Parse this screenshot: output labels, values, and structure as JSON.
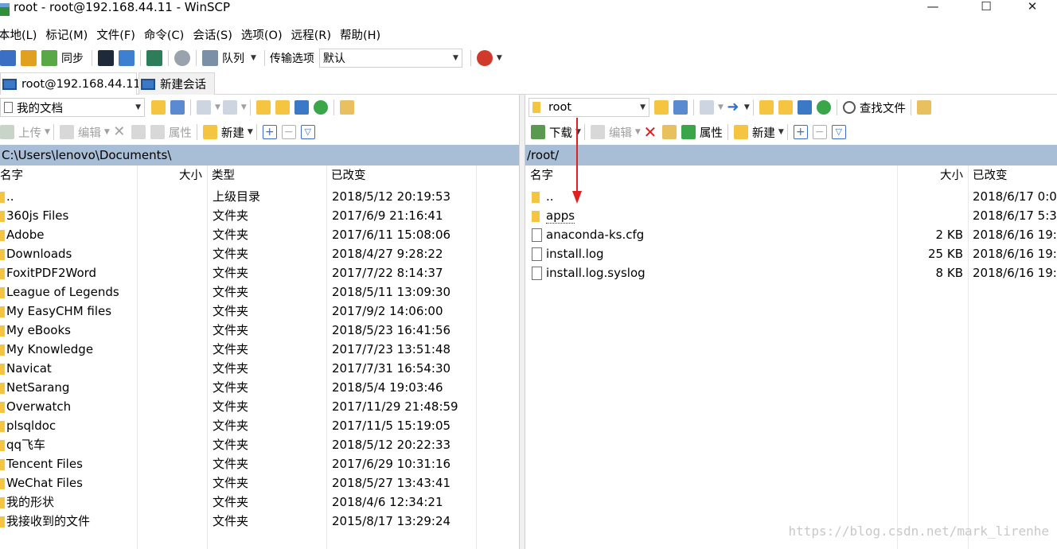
{
  "window": {
    "title": "root - root@192.168.44.11 - WinSCP",
    "minimize": "—",
    "maximize": "☐",
    "close": "✕"
  },
  "menu": [
    "本地(L)",
    "标记(M)",
    "文件(F)",
    "命令(C)",
    "会话(S)",
    "选项(O)",
    "远程(R)",
    "帮助(H)"
  ],
  "toolbar": {
    "sync_label": "同步",
    "queue_label": "队列",
    "transfer_options_label": "传输选项",
    "transfer_value": "默认"
  },
  "tabs": {
    "active": "root@192.168.44.11",
    "new_session": "新建会话"
  },
  "colors": {
    "path_bar": "#a8bdd6",
    "folder": "#f5c542",
    "delete_red": "#d92020",
    "arrow_red": "#e02020"
  },
  "left": {
    "location": "我的文档",
    "upload_label": "上传",
    "edit_label": "编辑",
    "properties_label": "属性",
    "new_label": "新建",
    "path": "C:\\Users\\lenovo\\Documents\\",
    "columns": {
      "name": "名字",
      "size": "大小",
      "type": "类型",
      "modified": "已改变"
    },
    "rows": [
      {
        "name": "..",
        "size": "",
        "type": "上级目录",
        "modified": "2018/5/12  20:19:53"
      },
      {
        "name": "360js Files",
        "size": "",
        "type": "文件夹",
        "modified": "2017/6/9  21:16:41"
      },
      {
        "name": "Adobe",
        "size": "",
        "type": "文件夹",
        "modified": "2017/6/11  15:08:06"
      },
      {
        "name": "Downloads",
        "size": "",
        "type": "文件夹",
        "modified": "2018/4/27  9:28:22"
      },
      {
        "name": "FoxitPDF2Word",
        "size": "",
        "type": "文件夹",
        "modified": "2017/7/22  8:14:37"
      },
      {
        "name": "League of Legends",
        "size": "",
        "type": "文件夹",
        "modified": "2018/5/11  13:09:30"
      },
      {
        "name": "My EasyCHM files",
        "size": "",
        "type": "文件夹",
        "modified": "2017/9/2  14:06:00"
      },
      {
        "name": "My eBooks",
        "size": "",
        "type": "文件夹",
        "modified": "2018/5/23  16:41:56"
      },
      {
        "name": "My Knowledge",
        "size": "",
        "type": "文件夹",
        "modified": "2017/7/23  13:51:48"
      },
      {
        "name": "Navicat",
        "size": "",
        "type": "文件夹",
        "modified": "2017/7/31  16:54:30"
      },
      {
        "name": "NetSarang",
        "size": "",
        "type": "文件夹",
        "modified": "2018/5/4  19:03:46"
      },
      {
        "name": "Overwatch",
        "size": "",
        "type": "文件夹",
        "modified": "2017/11/29  21:48:59"
      },
      {
        "name": "plsqldoc",
        "size": "",
        "type": "文件夹",
        "modified": "2017/11/5  15:19:05"
      },
      {
        "name": "qq飞车",
        "size": "",
        "type": "文件夹",
        "modified": "2018/5/12  20:22:33"
      },
      {
        "name": "Tencent Files",
        "size": "",
        "type": "文件夹",
        "modified": "2017/6/29  10:31:16"
      },
      {
        "name": "WeChat Files",
        "size": "",
        "type": "文件夹",
        "modified": "2018/5/27  13:43:41"
      },
      {
        "name": "我的形状",
        "size": "",
        "type": "文件夹",
        "modified": "2018/4/6  12:34:21"
      },
      {
        "name": "我接收到的文件",
        "size": "",
        "type": "文件夹",
        "modified": "2015/8/17  13:29:24"
      }
    ]
  },
  "right": {
    "location": "root",
    "download_label": "下载",
    "edit_label": "编辑",
    "properties_label": "属性",
    "new_label": "新建",
    "find_label": "查找文件",
    "path": "/root/",
    "columns": {
      "name": "名字",
      "size": "大小",
      "modified": "已改变"
    },
    "rows": [
      {
        "name": "..",
        "icon": "parent-folder-icon",
        "size": "",
        "modified": "2018/6/17 0:0("
      },
      {
        "name": "apps",
        "icon": "folder-icon",
        "size": "",
        "modified": "2018/6/17 5:3:"
      },
      {
        "name": "anaconda-ks.cfg",
        "icon": "file-icon",
        "size": "2 KB",
        "modified": "2018/6/16 19:1"
      },
      {
        "name": "install.log",
        "icon": "text-file-icon",
        "size": "25 KB",
        "modified": "2018/6/16 19:1"
      },
      {
        "name": "install.log.syslog",
        "icon": "text-file-icon",
        "size": "8 KB",
        "modified": "2018/6/16 19:1"
      }
    ]
  },
  "watermark": "https://blog.csdn.net/mark_lirenhe"
}
